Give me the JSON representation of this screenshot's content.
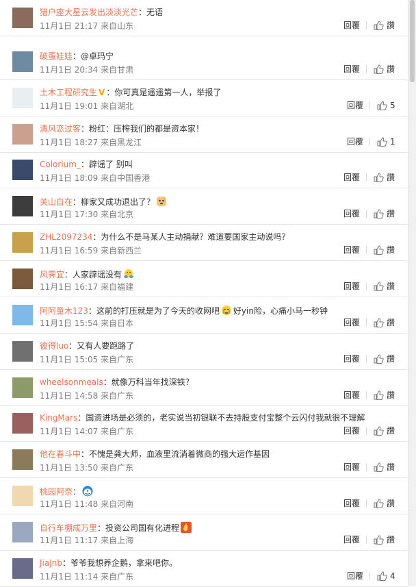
{
  "comments": [
    {
      "user": "猎户座大星云发出淡淡光芒",
      "verified": false,
      "text": "：无语",
      "time": "11月1日 21:17",
      "location": "来自山东",
      "reply": "回覆",
      "like": "讚"
    },
    {
      "user": "破蛋娃娃",
      "verified": false,
      "text": "：@卓玛宁",
      "time": "11月1日 20:34",
      "location": "来自甘肃",
      "reply": "回覆",
      "like": "讚"
    },
    {
      "user": "土木工程研究生",
      "verified": true,
      "text": "：你可真是遥遥第一人，举报了",
      "time": "11月1日 19:01",
      "location": "来自湖北",
      "reply": "回覆",
      "like": "5"
    },
    {
      "user": "清风恋过客",
      "verified": false,
      "text": "：粉红：压榨我们的都是资本家！",
      "time": "11月1日 18:27",
      "location": "来自黑龙江",
      "reply": "回覆",
      "like": "1"
    },
    {
      "user": "Colorium_",
      "verified": false,
      "text": "：辟谣了 别叫",
      "time": "11月1日 18:09",
      "location": "来自中国香港",
      "reply": "回覆",
      "like": "讚"
    },
    {
      "user": "关山自在",
      "verified": false,
      "text": "：柳家又成功退出了？",
      "emoji": "doge",
      "time": "11月1日 17:30",
      "location": "来自北京",
      "reply": "回覆",
      "like": "讚"
    },
    {
      "user": "ZHL2097234",
      "verified": false,
      "text": "：为什么不是马某人主动捐献？难道要国家主动说吗？",
      "time": "11月1日 16:59",
      "location": "来自新西兰",
      "reply": "回覆",
      "like": "讚"
    },
    {
      "user": "风霁宜",
      "verified": false,
      "text": "：人家辟谣没有",
      "emoji": "hug",
      "time": "11月1日 16:17",
      "location": "来自福建",
      "reply": "回覆",
      "like": "讚"
    },
    {
      "user": "阿阿童木123",
      "verified": false,
      "text": "：这前的打压就是为了今天的收网吧",
      "emoji": "cry",
      "text_after": "好yin险，心痛小马一秒钟",
      "time": "11月1日 15:54",
      "location": "来自日本",
      "reply": "回覆",
      "like": "讚"
    },
    {
      "user": "彼得luo",
      "verified": false,
      "text": "：又有人要跑路了",
      "time": "11月1日 15:05",
      "location": "来自广东",
      "reply": "回覆",
      "like": "讚"
    },
    {
      "user": "wheelsonmeals",
      "verified": false,
      "text": "：就像万科当年找深铁？",
      "time": "11月1日 14:58",
      "location": "来自广东",
      "reply": "回覆",
      "like": "讚"
    },
    {
      "user": "KingMars",
      "verified": false,
      "text": "：国资进场是必须的，老实说当初银联不去持股支付宝整个云闪付我就很不理解",
      "time": "11月1日 14:07",
      "location": "来自广东",
      "reply": "回覆",
      "like": "讚"
    },
    {
      "user": "他在春斗中",
      "verified": false,
      "text": "：不愧是龚大师，血液里流淌着微商的强大运作基因",
      "time": "11月1日 13:50",
      "location": "来自广东",
      "reply": "回覆",
      "like": "讚"
    },
    {
      "user": "桃园阿奈",
      "verified": false,
      "text": "：",
      "emoji": "doraemon",
      "time": "11月1日 11:48",
      "location": "来自河南",
      "reply": "回覆",
      "like": "讚"
    },
    {
      "user": "自行车棚成万里",
      "verified": false,
      "text": "：投资公司国有化进程",
      "emoji": "fire",
      "time": "11月1日 11:17",
      "location": "来自上海",
      "reply": "回覆",
      "like": "讚"
    },
    {
      "user": "JiaJnb",
      "verified": false,
      "text": "：爷爷我想养企鹅，拿来吧你。",
      "time": "11月1日 11:14",
      "location": "来自广东",
      "reply": "回覆",
      "like": "4"
    }
  ],
  "colors": {
    "username": "#eb7350",
    "meta": "#808080",
    "verified": "#ffa200",
    "divider": "#e6e6e6"
  }
}
